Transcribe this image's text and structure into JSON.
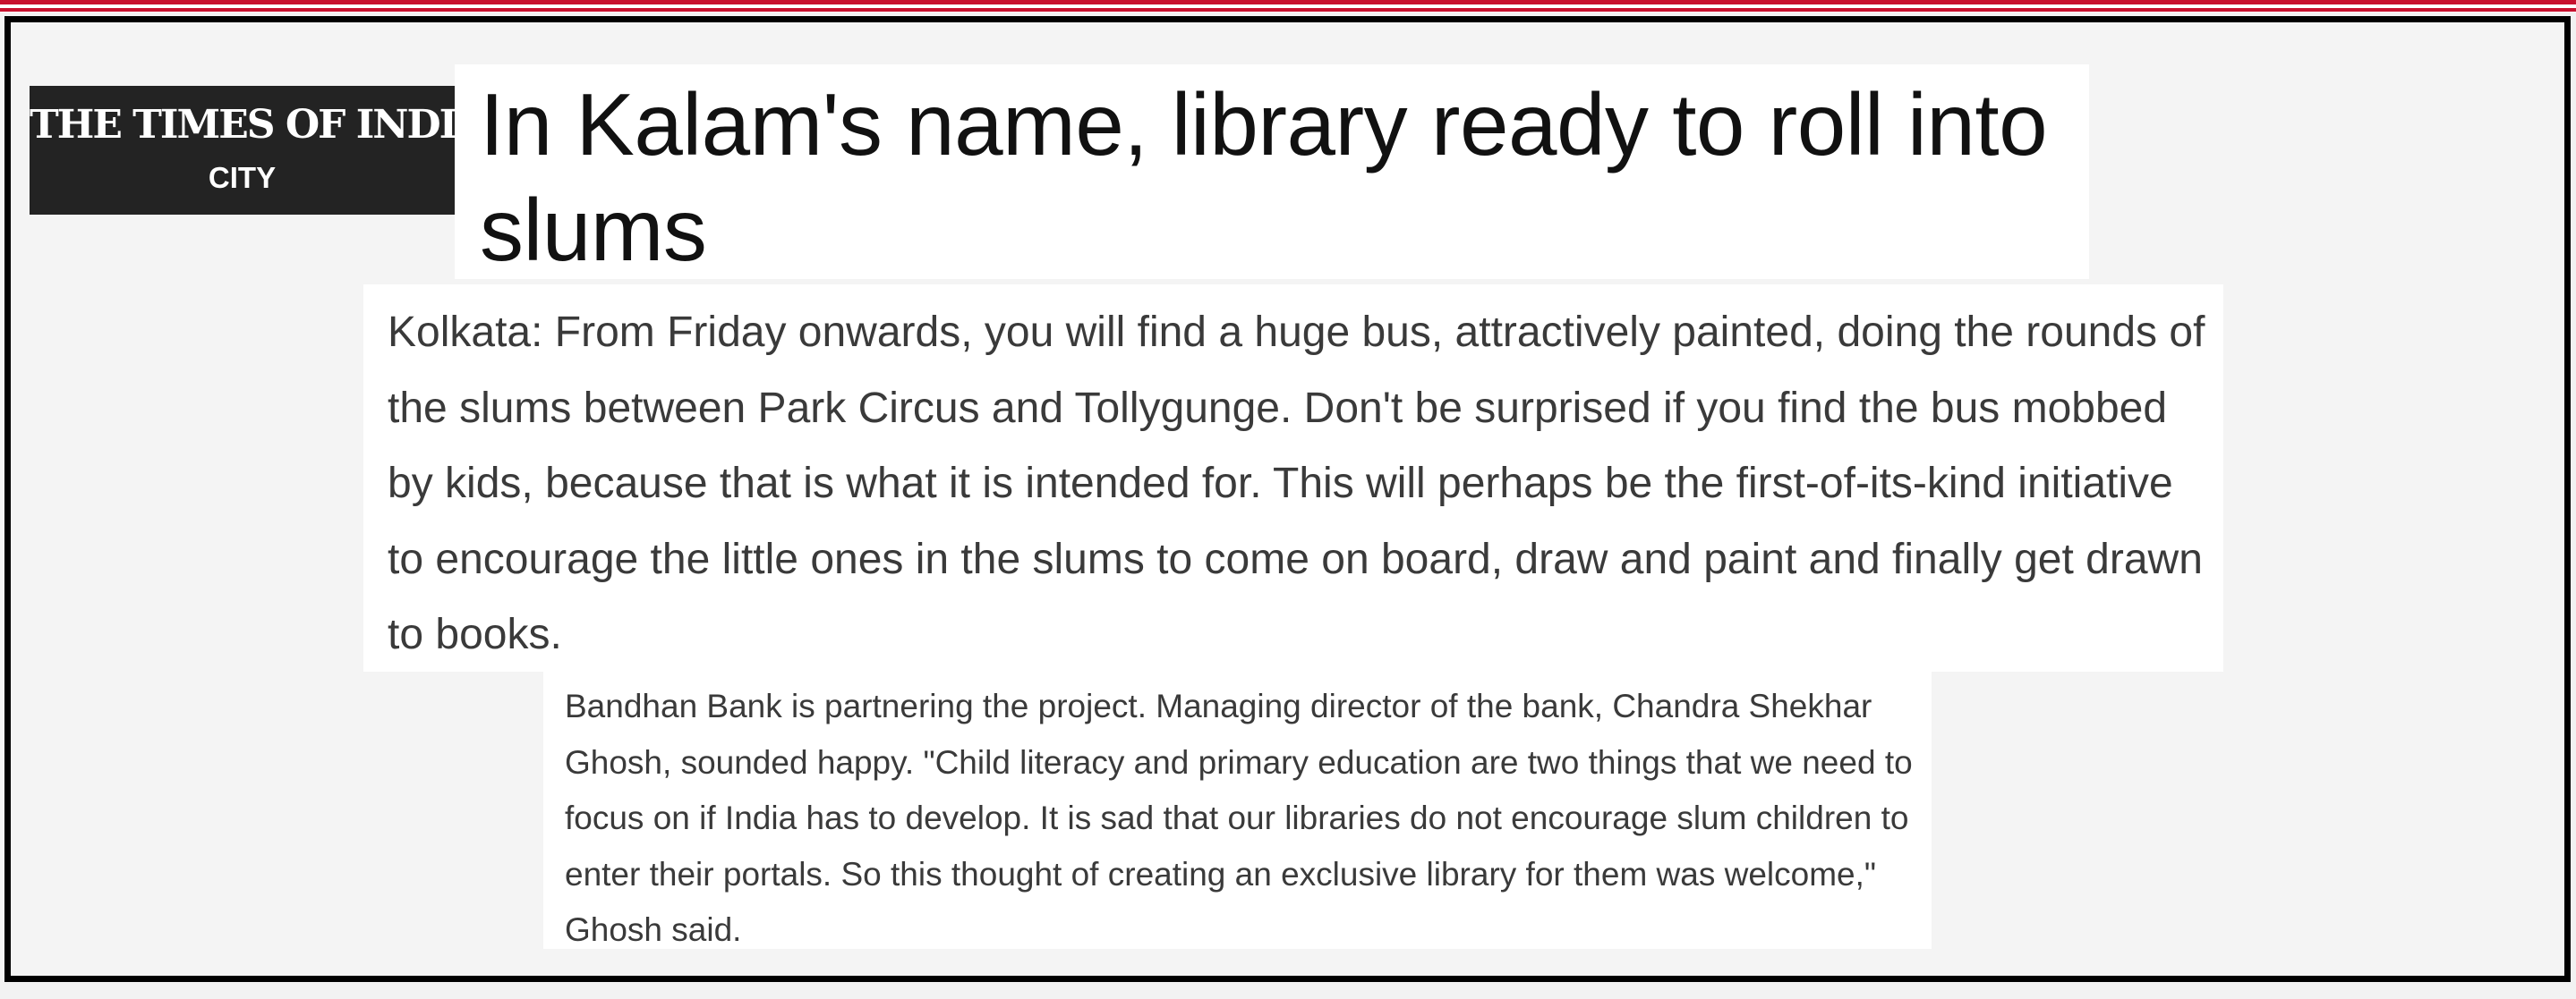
{
  "masthead": {
    "publication": "THE TIMES OF INDIA",
    "section": "CITY"
  },
  "article": {
    "headline": "In Kalam's name, library ready to roll into slums",
    "lede": "Kolkata: From Friday onwards, you will find a huge bus, attractively painted, doing the rounds of the slums between Park Circus and Tollygunge. Don't be surprised if you find the bus mobbed by kids, because that is what it is intended for. This will perhaps be the first-of-its-kind initiative to encourage the little ones in the slums to come on board, draw and paint and finally get drawn to books.",
    "body": "Bandhan Bank is partnering the project. Managing director of the bank, Chandra Shekhar Ghosh, sounded happy. \"Child literacy and primary education are two things that we need to focus on if India has to develop. It is sad that our libraries do not encourage slum children to enter their portals. So this thought of creating an exclusive library for them was welcome,\" Ghosh said."
  },
  "colors": {
    "accent_red": "#c8102e",
    "masthead_bg": "#232323",
    "frame": "#000000",
    "background": "#f4f4f4"
  }
}
